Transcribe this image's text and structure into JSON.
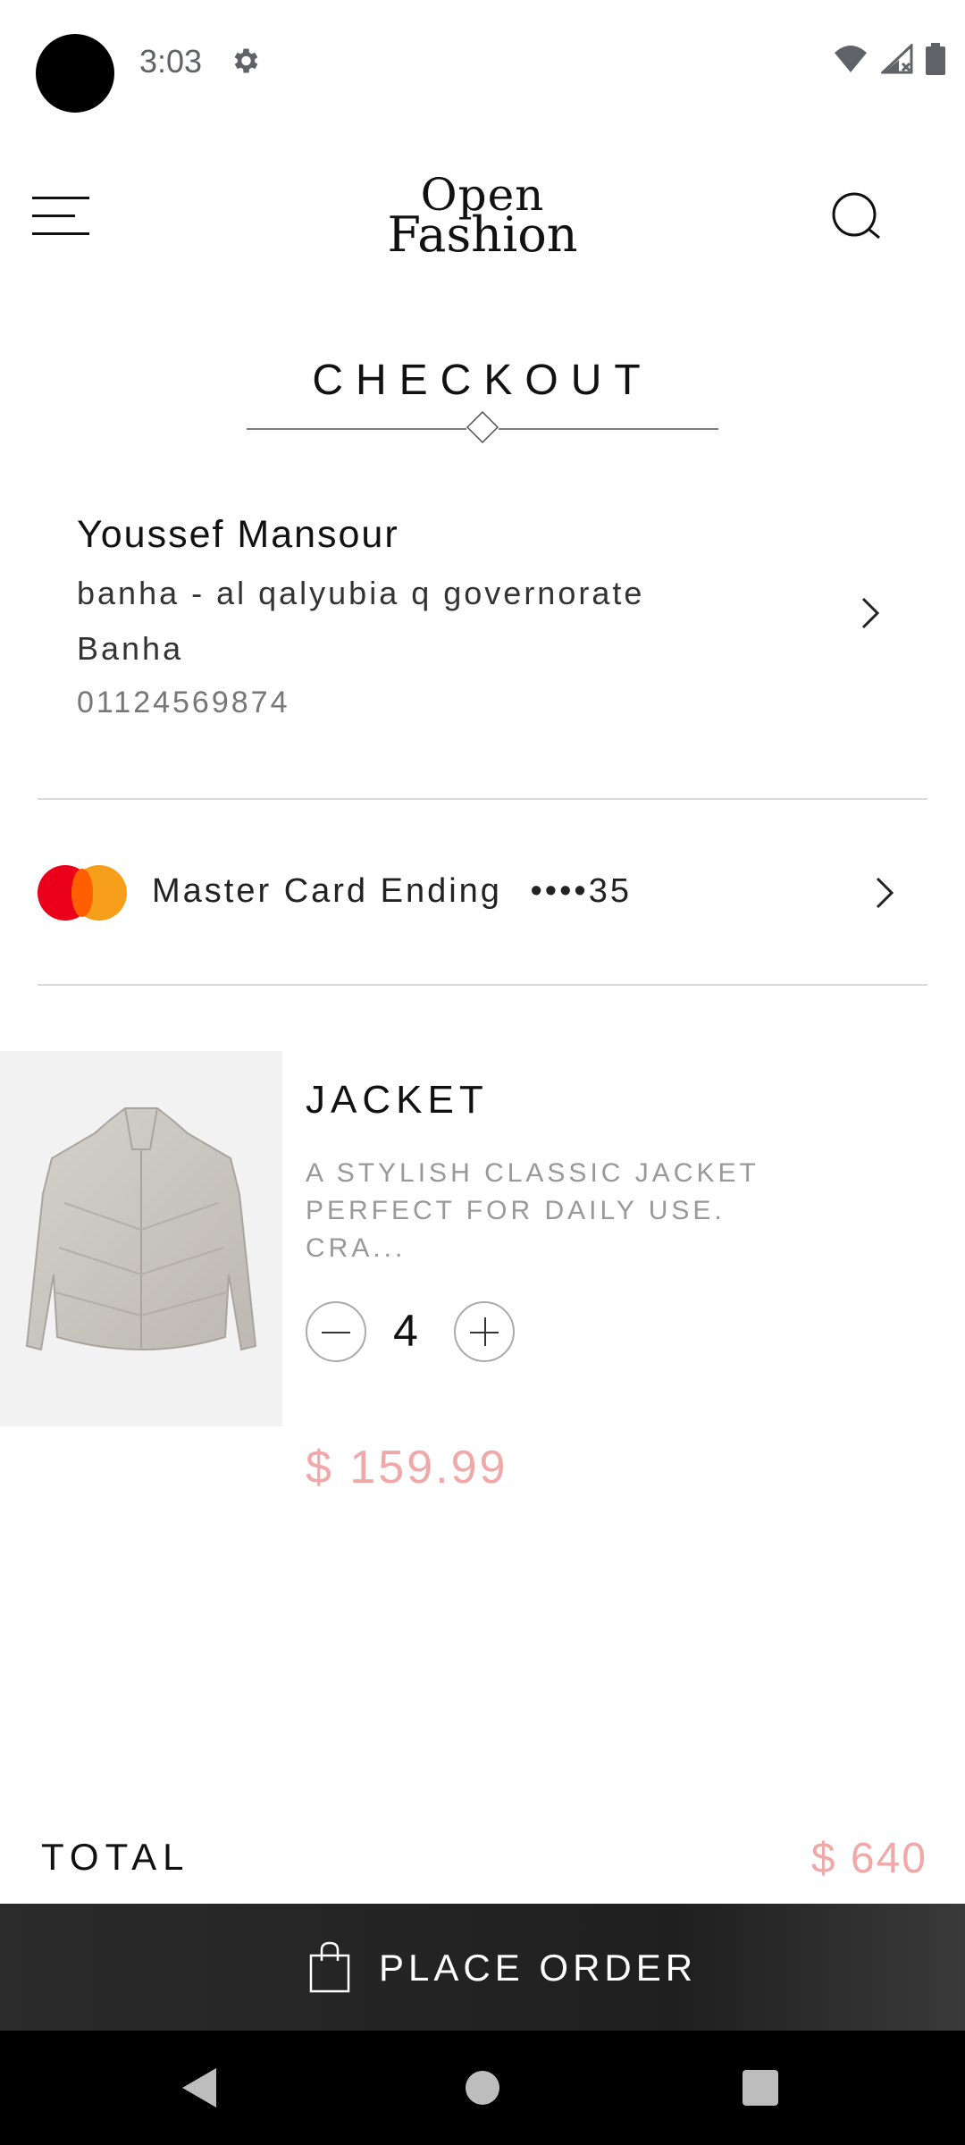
{
  "status_bar": {
    "time": "3:03",
    "icons": [
      "settings-icon",
      "wifi-icon",
      "signal-icon",
      "battery-icon"
    ]
  },
  "header": {
    "logo_line1": "Open",
    "logo_line2": "Fashion",
    "icons": [
      "menu-icon",
      "search-icon"
    ]
  },
  "page": {
    "title": "CHECKOUT"
  },
  "address": {
    "name": "Youssef Mansour",
    "line1": "banha - al qalyubia q governorate",
    "line2": "Banha",
    "phone": "01124569874"
  },
  "payment": {
    "label": "Master Card Ending",
    "card_suffix": "••••35"
  },
  "product": {
    "name": "JACKET",
    "description": "A STYLISH CLASSIC JACKET PERFECT FOR DAILY USE. CRA...",
    "quantity": "4",
    "price": "$ 159.99"
  },
  "total": {
    "label": "TOTAL",
    "value": "$ 640"
  },
  "actions": {
    "place_order": "PLACE ORDER"
  },
  "colors": {
    "accent_price": "#f0a8a8",
    "button_bg": "#242424",
    "divider": "#d9d9d9"
  }
}
